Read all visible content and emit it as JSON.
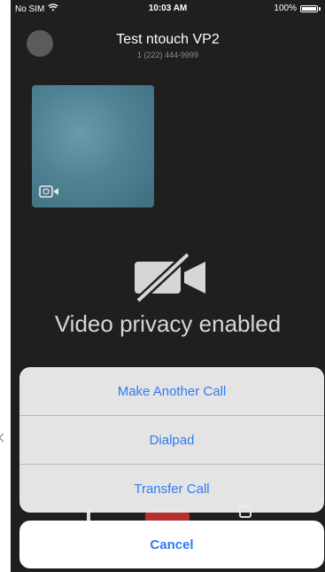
{
  "status_bar": {
    "carrier": "No SIM",
    "time": "10:03 AM",
    "battery": "100%"
  },
  "call": {
    "name": "Test ntouch VP2",
    "number": "1 (222) 444-9999"
  },
  "privacy": {
    "message": "Video privacy enabled"
  },
  "action_sheet": {
    "actions": [
      {
        "label": "Make Another Call"
      },
      {
        "label": "Dialpad"
      },
      {
        "label": "Transfer Call"
      }
    ],
    "cancel_label": "Cancel"
  },
  "colors": {
    "action_blue": "#2f7bf2",
    "background": "#1f1f1f",
    "end_call_red": "#d03535"
  },
  "icons": {
    "wifi": "wifi-icon",
    "battery": "battery-icon",
    "switch_camera": "switch-camera-icon",
    "privacy": "video-off-icon"
  }
}
